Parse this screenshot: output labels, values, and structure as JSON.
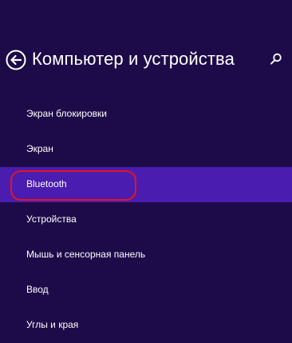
{
  "header": {
    "title": "Компьютер и устройства",
    "back_icon": "back-arrow-circle-icon",
    "search_icon": "search-icon"
  },
  "nav": {
    "items": [
      {
        "label": "Экран блокировки"
      },
      {
        "label": "Экран"
      },
      {
        "label": "Bluetooth"
      },
      {
        "label": "Устройства"
      },
      {
        "label": "Мышь и сенсорная панель"
      },
      {
        "label": "Ввод"
      },
      {
        "label": "Углы и края"
      }
    ],
    "selected_label": "Bluetooth"
  },
  "colors": {
    "background": "#1d0b49",
    "selected": "#4a1cb0",
    "highlight_ring": "#e3161d",
    "text": "#ffffff"
  }
}
